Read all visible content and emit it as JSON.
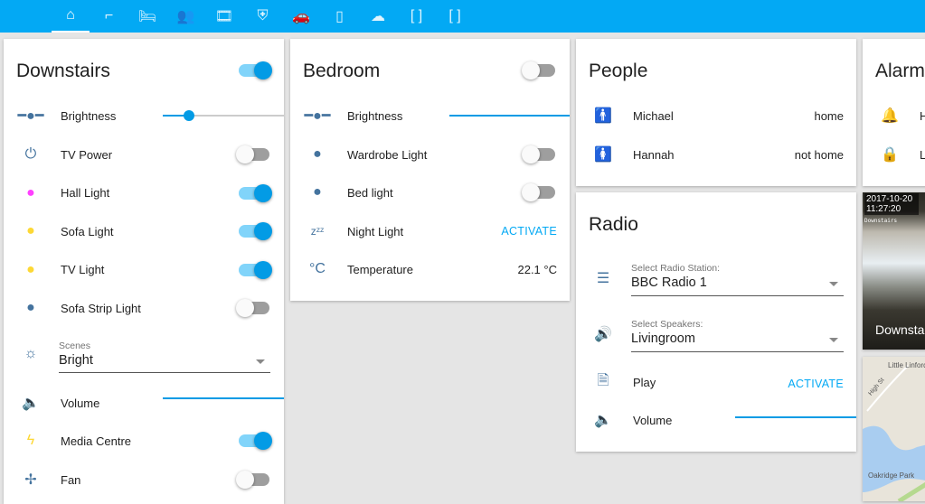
{
  "nav": {
    "tabs": [
      {
        "icon": "home-icon",
        "glyph": "⌂"
      },
      {
        "icon": "stairs-icon",
        "glyph": "⌐"
      },
      {
        "icon": "bed-icon",
        "glyph": "🛏"
      },
      {
        "icon": "people-icon",
        "glyph": "👥"
      },
      {
        "icon": "film-icon",
        "glyph": "🎞"
      },
      {
        "icon": "shield-home-icon",
        "glyph": "⛨"
      },
      {
        "icon": "car-icon",
        "glyph": "🚗"
      },
      {
        "icon": "phone-icon",
        "glyph": "▯"
      },
      {
        "icon": "cloud-icon",
        "glyph": "☁"
      },
      {
        "icon": "bracket-icon",
        "glyph": "[ ]"
      },
      {
        "icon": "bracket-icon",
        "glyph": "[ ]"
      }
    ]
  },
  "downstairs": {
    "title": "Downstairs",
    "master_on": true,
    "brightness": {
      "label": "Brightness",
      "value_pct": 22
    },
    "items": [
      {
        "label": "TV Power",
        "on": false,
        "color": "#44739e"
      },
      {
        "label": "Hall Light",
        "on": true,
        "color": "#ff40ff"
      },
      {
        "label": "Sofa Light",
        "on": true,
        "color": "#fdd835"
      },
      {
        "label": "TV Light",
        "on": true,
        "color": "#fdd835"
      },
      {
        "label": "Sofa Strip Light",
        "on": false,
        "color": "#44739e"
      }
    ],
    "scenes": {
      "label": "Scenes",
      "value": "Bright"
    },
    "volume": {
      "label": "Volume",
      "value_pct": 100
    },
    "media": {
      "label": "Media Centre",
      "on": true,
      "color": "#fdd835"
    },
    "fan": {
      "label": "Fan",
      "on": false
    }
  },
  "bedroom": {
    "title": "Bedroom",
    "master_on": false,
    "brightness": {
      "label": "Brightness",
      "value_pct": 100
    },
    "wardrobe": {
      "label": "Wardrobe Light",
      "on": false
    },
    "bed": {
      "label": "Bed light",
      "on": false
    },
    "night": {
      "label": "Night Light",
      "action": "ACTIVATE"
    },
    "temp": {
      "label": "Temperature",
      "value": "22.1 °C"
    }
  },
  "people": {
    "title": "People",
    "items": [
      {
        "name": "Michael",
        "state": "home"
      },
      {
        "name": "Hannah",
        "state": "not home"
      }
    ]
  },
  "radio": {
    "title": "Radio",
    "station": {
      "label": "Select Radio Station:",
      "value": "BBC Radio 1"
    },
    "speakers": {
      "label": "Select Speakers:",
      "value": "Livingroom"
    },
    "play": {
      "label": "Play",
      "action": "ACTIVATE"
    },
    "volume": {
      "label": "Volume",
      "value_pct": 100
    }
  },
  "alarm": {
    "title": "Alarm",
    "rows": [
      "H",
      "L"
    ]
  },
  "camera": {
    "timestamp": "2017-10-20 11:27:20",
    "overlay": "Downstairs",
    "name": "Downstairs"
  },
  "map": {
    "labels": [
      "Little Linford",
      "High St",
      "Oakridge Park"
    ]
  }
}
